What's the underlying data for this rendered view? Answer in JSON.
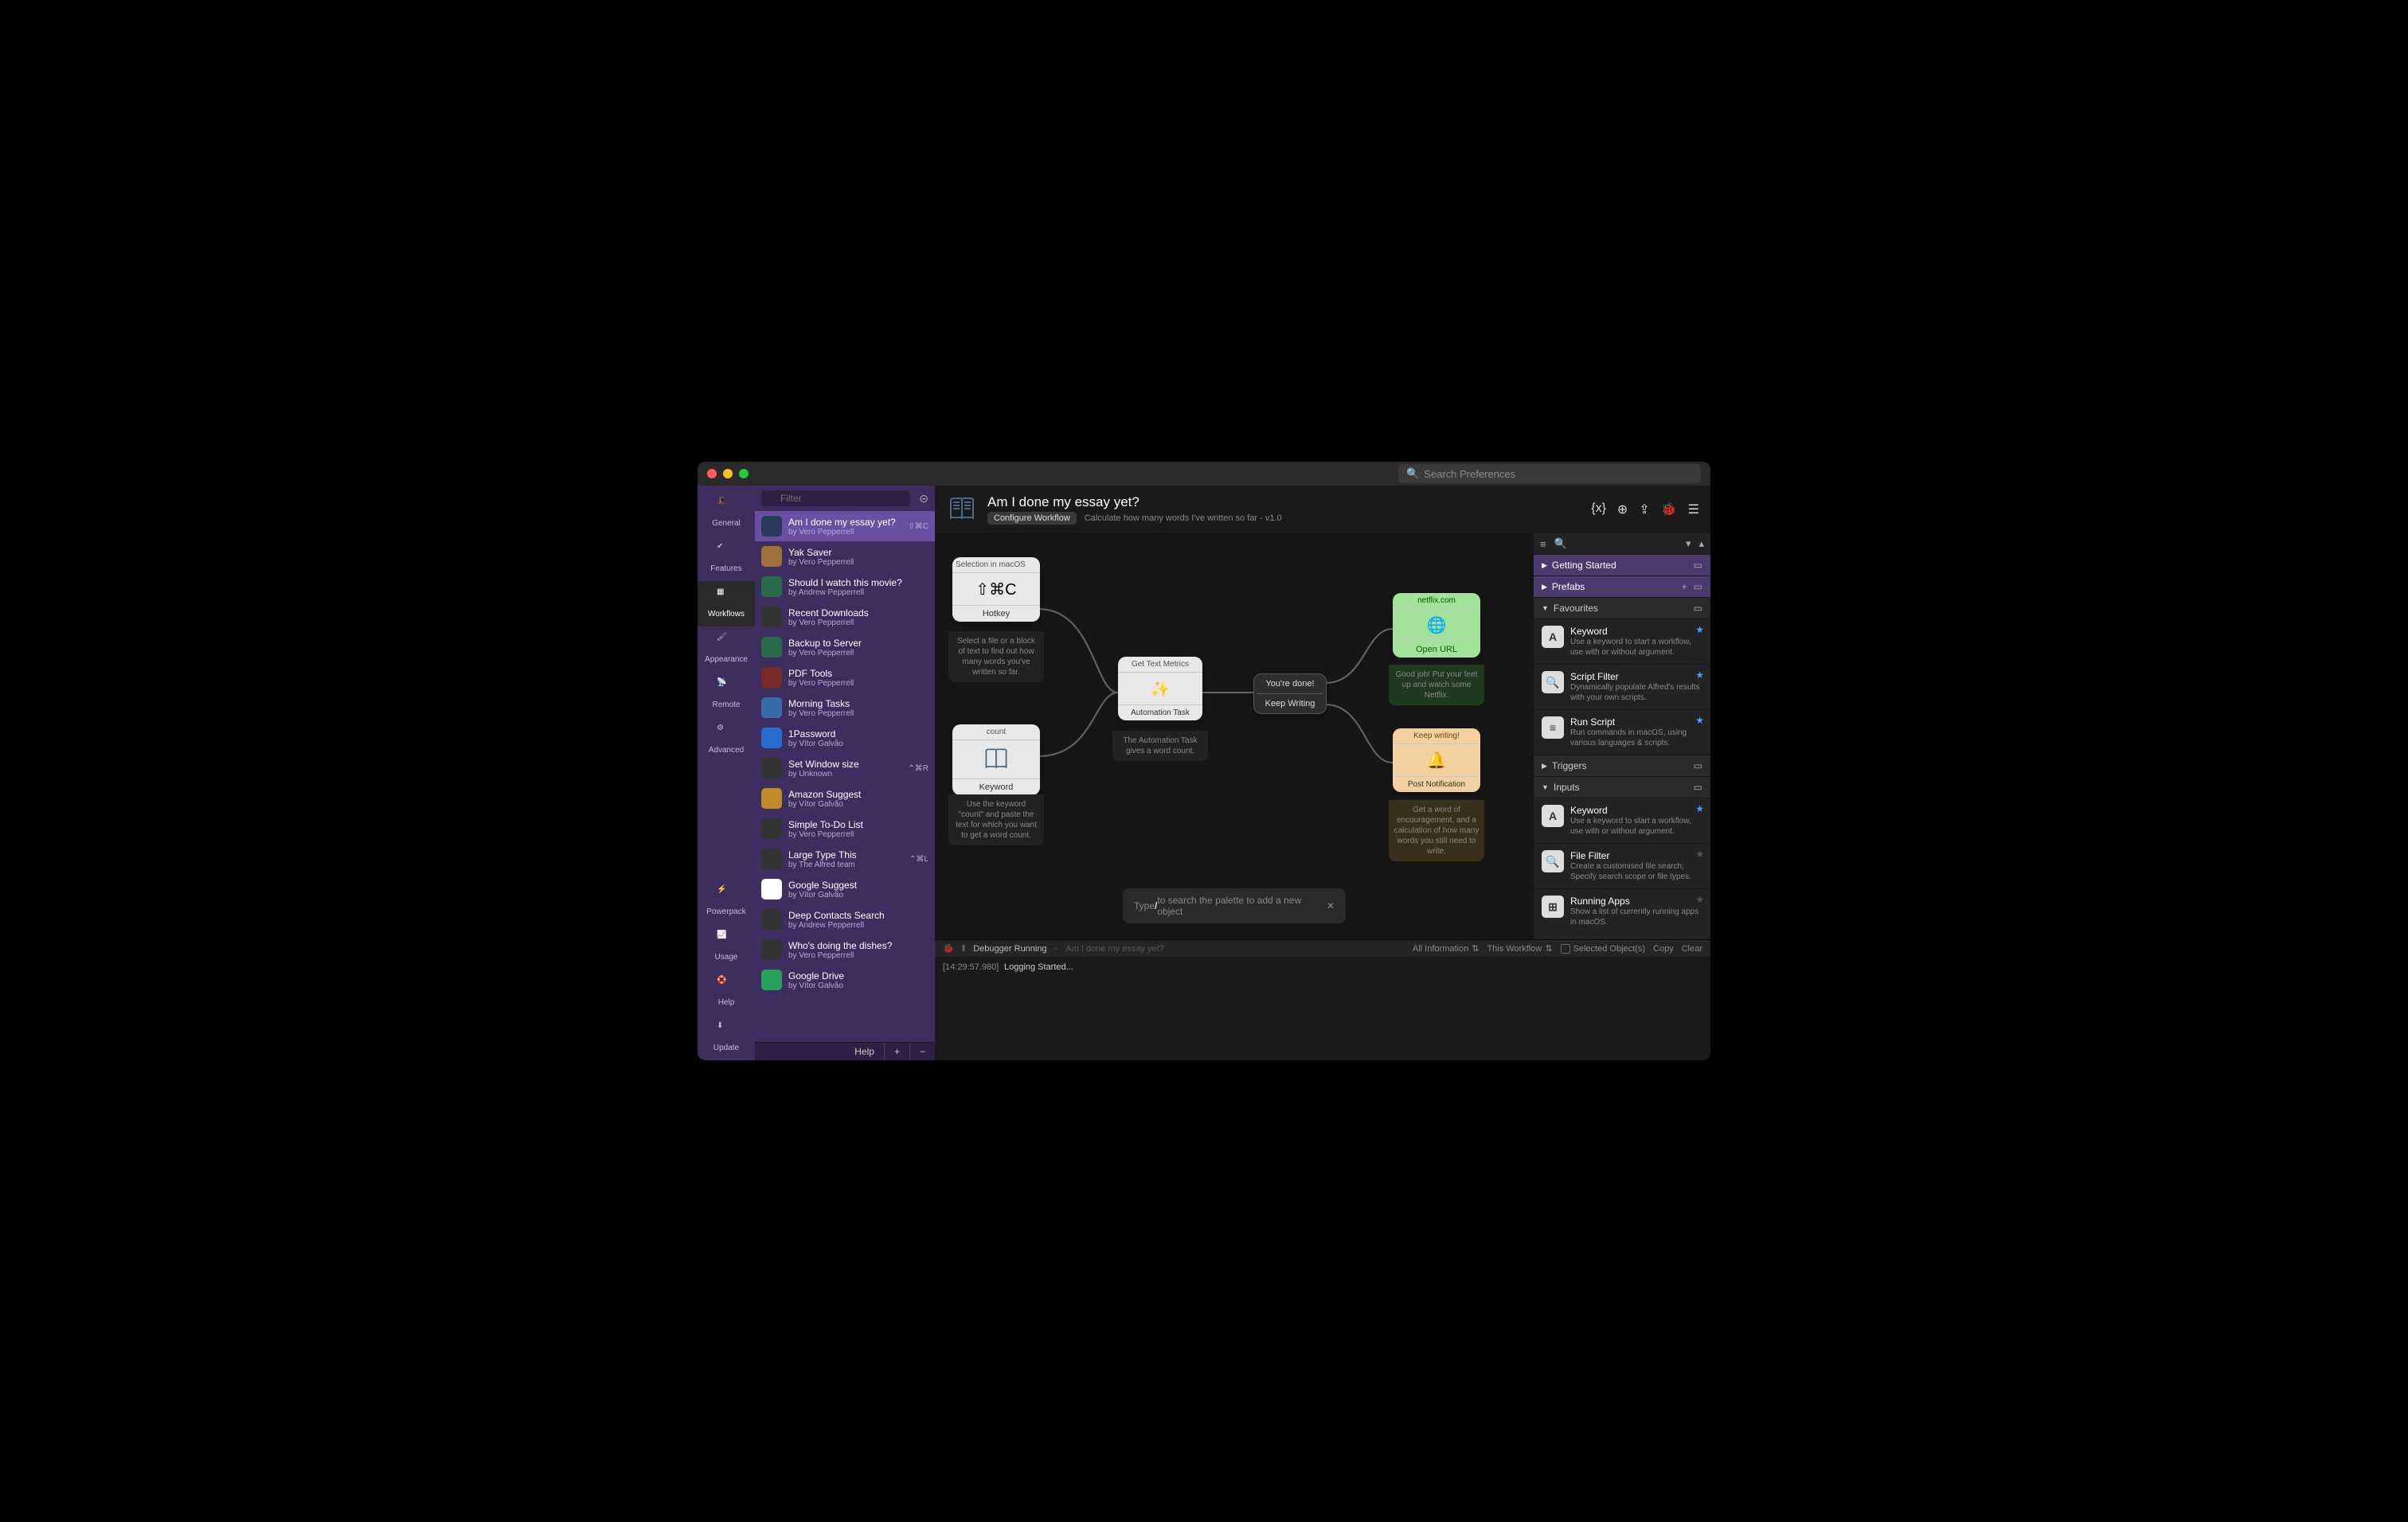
{
  "titlebar": {
    "search_placeholder": "Search Preferences"
  },
  "rail": [
    {
      "id": "general",
      "label": "General"
    },
    {
      "id": "features",
      "label": "Features"
    },
    {
      "id": "workflows",
      "label": "Workflows"
    },
    {
      "id": "appearance",
      "label": "Appearance"
    },
    {
      "id": "remote",
      "label": "Remote"
    },
    {
      "id": "advanced",
      "label": "Advanced"
    }
  ],
  "rail_bottom": [
    {
      "id": "powerpack",
      "label": "Powerpack"
    },
    {
      "id": "usage",
      "label": "Usage"
    },
    {
      "id": "help",
      "label": "Help"
    },
    {
      "id": "update",
      "label": "Update"
    }
  ],
  "sidebar": {
    "filter_placeholder": "Filter",
    "items": [
      {
        "title": "Am I done my essay yet?",
        "author": "by Vero Pepperrell",
        "shortcut": "⇧⌘C",
        "selected": true
      },
      {
        "title": "Yak Saver",
        "author": "by Vero Pepperrell"
      },
      {
        "title": "Should I watch this movie?",
        "author": "by Andrew Pepperrell"
      },
      {
        "title": "Recent Downloads",
        "author": "by Vero Pepperrell"
      },
      {
        "title": "Backup to Server",
        "author": "by Vero Pepperrell"
      },
      {
        "title": "PDF Tools",
        "author": "by Vero Pepperrell"
      },
      {
        "title": "Morning Tasks",
        "author": "by Vero Pepperrell"
      },
      {
        "title": "1Password",
        "author": "by Vítor Galvão"
      },
      {
        "title": "Set Window size",
        "author": "by Unknown",
        "shortcut": "⌃⌘R"
      },
      {
        "title": "Amazon Suggest",
        "author": "by Vítor Galvão"
      },
      {
        "title": "Simple To-Do List",
        "author": "by Vero Pepperrell"
      },
      {
        "title": "Large Type This",
        "author": "by The Alfred team",
        "shortcut": "⌃⌘L"
      },
      {
        "title": "Google Suggest",
        "author": "by Vítor Galvão"
      },
      {
        "title": "Deep Contacts Search",
        "author": "by Andrew Pepperrell"
      },
      {
        "title": "Who's doing the dishes?",
        "author": "by Vero Pepperrell"
      },
      {
        "title": "Google Drive",
        "author": "by Vítor Galvão"
      }
    ],
    "footer": {
      "help": "Help",
      "add": "+",
      "remove": "−"
    }
  },
  "header": {
    "title": "Am I done my essay yet?",
    "configure": "Configure Workflow",
    "desc": "Calculate how many words I've written so far - v1.0"
  },
  "canvas": {
    "hotkey": {
      "head": "Selection in macOS",
      "body": "⇧⌘C",
      "foot": "Hotkey",
      "desc": "Select a file or a block of text to find out how many words you've written so far."
    },
    "keyword": {
      "head": "count",
      "foot": "Keyword",
      "desc": "Use the keyword \"count\" and paste the text for which you want to get a word count."
    },
    "metrics": {
      "head": "Get Text Metrics",
      "foot": "Automation Task",
      "desc": "The Automation Task gives a word count."
    },
    "split": {
      "done": "You're done!",
      "keep": "Keep Writing"
    },
    "netflix": {
      "head": "netflix.com",
      "foot": "Open URL",
      "desc": "Good job! Put your feet up and watch some Netflix."
    },
    "notify": {
      "head": "Keep writing!",
      "foot": "Post Notification",
      "desc": "Get a word of encouragement, and a calculation of how many words you still need to write."
    },
    "palette_hint_a": "Type ",
    "palette_hint_b": "/",
    "palette_hint_c": " to search the palette to add a new object"
  },
  "palette": {
    "sections": {
      "getting_started": "Getting Started",
      "prefabs": "Prefabs",
      "favourites": "Favourites",
      "triggers": "Triggers",
      "inputs": "Inputs"
    },
    "favourites": [
      {
        "title": "Keyword",
        "desc": "Use a keyword to start a workflow, use with or without argument.",
        "glyph": "A",
        "star": true
      },
      {
        "title": "Script Filter",
        "desc": "Dynamically populate Alfred's results with your own scripts.",
        "glyph": "🔍",
        "star": true
      },
      {
        "title": "Run Script",
        "desc": "Run commands in macOS, using various languages & scripts.",
        "glyph": "≡",
        "star": true
      }
    ],
    "inputs": [
      {
        "title": "Keyword",
        "desc": "Use a keyword to start a workflow, use with or without argument.",
        "glyph": "A",
        "star": true
      },
      {
        "title": "File Filter",
        "desc": "Create a customised file search; Specify search scope or file types.",
        "glyph": "🔍",
        "star": false
      },
      {
        "title": "Running Apps",
        "desc": "Show a list of currently running apps in macOS.",
        "glyph": "⊞",
        "star": false
      }
    ]
  },
  "debugger": {
    "status": "Debugger Running",
    "context": "Am I done my essay yet?",
    "filter1": "All Information",
    "filter2": "This Workflow",
    "selected": "Selected Object(s)",
    "copy": "Copy",
    "clear": "Clear",
    "log_ts": "[14:29:57.980]",
    "log_msg": "Logging Started..."
  }
}
